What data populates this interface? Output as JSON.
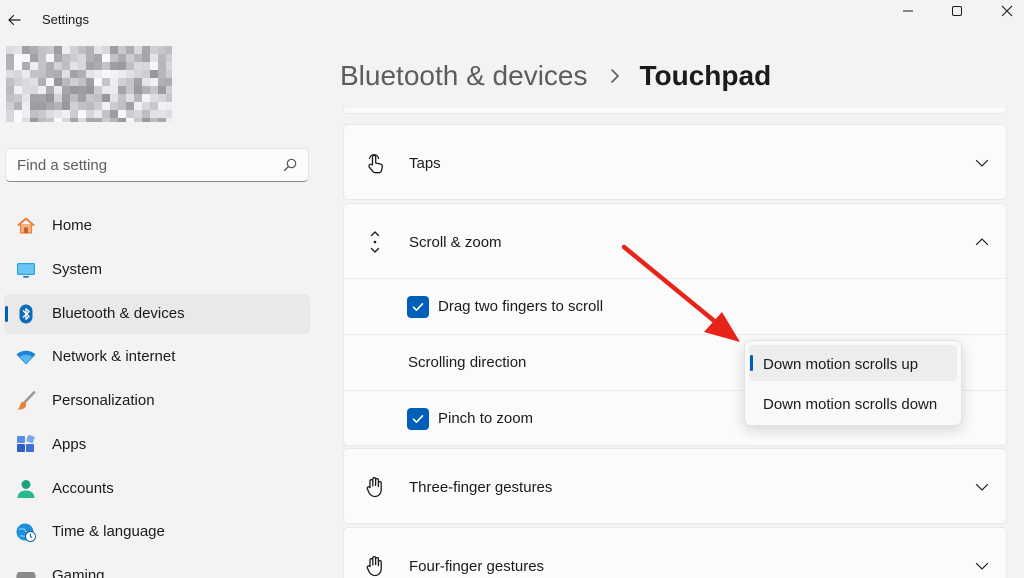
{
  "window": {
    "app_title": "Settings",
    "controls": {
      "minimize": "minimize-icon",
      "maximize": "maximize-icon",
      "close": "close-icon"
    }
  },
  "search": {
    "placeholder": "Find a setting",
    "value": ""
  },
  "sidebar": {
    "active_index": 2,
    "items": [
      {
        "label": "Home",
        "icon": "home-icon",
        "color": "#e8833a"
      },
      {
        "label": "System",
        "icon": "system-icon",
        "color": "#0f8fd8"
      },
      {
        "label": "Bluetooth & devices",
        "icon": "bluetooth-icon",
        "color": "#0f6cbd"
      },
      {
        "label": "Network & internet",
        "icon": "wifi-icon",
        "color": "#1a86d9"
      },
      {
        "label": "Personalization",
        "icon": "brush-icon",
        "color": "#d9822b"
      },
      {
        "label": "Apps",
        "icon": "apps-icon",
        "color": "#3a6fd8"
      },
      {
        "label": "Accounts",
        "icon": "accounts-icon",
        "color": "#1aa37a"
      },
      {
        "label": "Time & language",
        "icon": "globe-clock-icon",
        "color": "#1f8fd9"
      },
      {
        "label": "Gaming",
        "icon": "gaming-icon",
        "color": "#7a7a7a"
      }
    ]
  },
  "breadcrumb": {
    "parent": "Bluetooth & devices",
    "current": "Touchpad"
  },
  "sections": {
    "taps": {
      "title": "Taps",
      "icon": "tap-gesture-icon",
      "expanded": false
    },
    "scroll_zoom": {
      "title": "Scroll & zoom",
      "icon": "scroll-arrows-icon",
      "expanded": true,
      "drag_two_fingers": {
        "label": "Drag two fingers to scroll",
        "checked": true
      },
      "scrolling_direction": {
        "label": "Scrolling direction"
      },
      "pinch_to_zoom": {
        "label": "Pinch to zoom",
        "checked": true
      }
    },
    "three_finger": {
      "title": "Three-finger gestures",
      "icon": "hand-gesture-icon",
      "expanded": false
    },
    "four_finger": {
      "title": "Four-finger gestures",
      "icon": "hand-gesture-icon",
      "expanded": false
    }
  },
  "dropdown": {
    "options": [
      "Down motion scrolls up",
      "Down motion scrolls down"
    ],
    "selected_index": 0
  },
  "colors": {
    "accent": "#005fb8",
    "annotation_arrow": "#e8231a"
  }
}
